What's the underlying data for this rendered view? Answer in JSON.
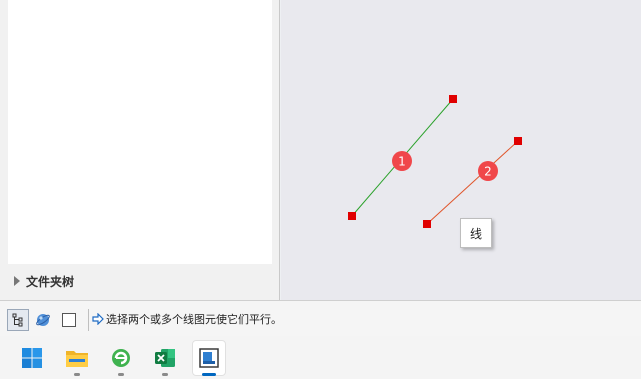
{
  "left_panel": {
    "folder_tree_label": "文件夹树"
  },
  "canvas": {
    "lines": [
      {
        "label": "1",
        "color": "#2aa12a"
      },
      {
        "label": "2",
        "color": "#e0552a"
      }
    ],
    "endpoint_color": "#e00000",
    "marker_color": "#f0474a",
    "tooltip": "线"
  },
  "statusbar": {
    "buttons": [
      "snap-tree-icon",
      "globe-icon",
      "window-icon"
    ],
    "message": "选择两个或多个线图元使它们平行。"
  },
  "taskbar": {
    "apps": [
      "windows-start-icon",
      "file-explorer-icon",
      "browser-icon",
      "excel-icon",
      "cad-app-icon"
    ]
  }
}
